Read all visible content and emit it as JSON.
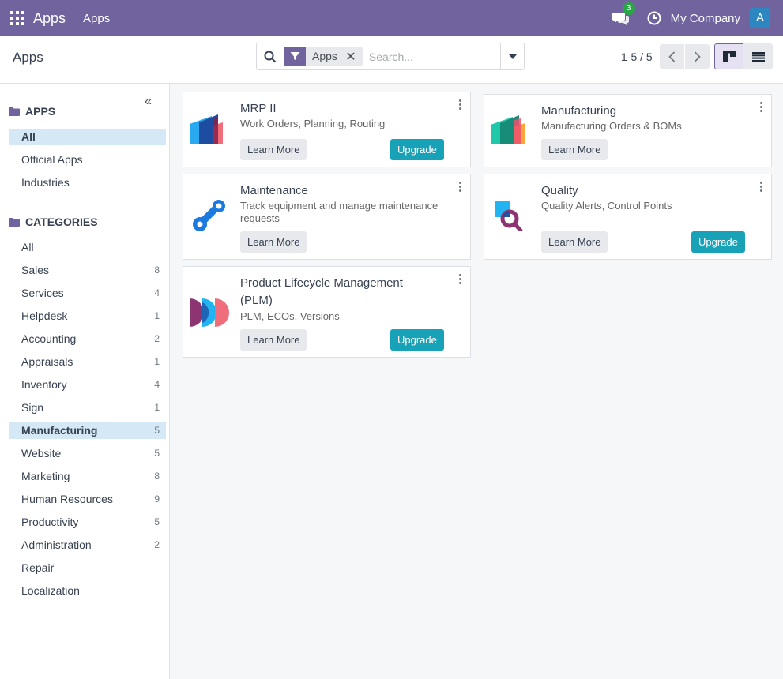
{
  "navbar": {
    "brand": "Apps",
    "menu_item": "Apps",
    "chat_count": "3",
    "company": "My Company",
    "avatar_letter": "A"
  },
  "control_panel": {
    "breadcrumb": "Apps",
    "facet_label": "Apps",
    "search_placeholder": "Search...",
    "pager": "1-5 / 5"
  },
  "sidebar": {
    "apps_title": "APPS",
    "apps_items": [
      {
        "label": "All",
        "active": true
      },
      {
        "label": "Official Apps"
      },
      {
        "label": "Industries"
      }
    ],
    "categories_title": "CATEGORIES",
    "categories": [
      {
        "label": "All",
        "count": ""
      },
      {
        "label": "Sales",
        "count": "8"
      },
      {
        "label": "Services",
        "count": "4"
      },
      {
        "label": "Helpdesk",
        "count": "1"
      },
      {
        "label": "Accounting",
        "count": "2"
      },
      {
        "label": "Appraisals",
        "count": "1"
      },
      {
        "label": "Inventory",
        "count": "4"
      },
      {
        "label": "Sign",
        "count": "1"
      },
      {
        "label": "Manufacturing",
        "count": "5",
        "active": true
      },
      {
        "label": "Website",
        "count": "5"
      },
      {
        "label": "Marketing",
        "count": "8"
      },
      {
        "label": "Human Resources",
        "count": "9"
      },
      {
        "label": "Productivity",
        "count": "5"
      },
      {
        "label": "Administration",
        "count": "2"
      },
      {
        "label": "Repair",
        "count": ""
      },
      {
        "label": "Localization",
        "count": ""
      }
    ]
  },
  "cards": {
    "mrp": {
      "title": "MRP II",
      "desc": "Work Orders, Planning, Routing",
      "learn": "Learn More",
      "upgrade": "Upgrade"
    },
    "mfg": {
      "title": "Manufacturing",
      "desc": "Manufacturing Orders & BOMs",
      "learn": "Learn More"
    },
    "maint": {
      "title": "Maintenance",
      "desc": "Track equipment and manage maintenance requests",
      "learn": "Learn More"
    },
    "quality": {
      "title": "Quality",
      "desc": "Quality Alerts, Control Points",
      "learn": "Learn More",
      "upgrade": "Upgrade"
    },
    "plm": {
      "title": "Product Lifecycle Management (PLM)",
      "desc": "PLM, ECOs, Versions",
      "learn": "Learn More",
      "upgrade": "Upgrade"
    }
  },
  "colors": {
    "navbar": "#71639e",
    "upgrade": "#17a2b8",
    "active_item": "#d5e8f5"
  }
}
